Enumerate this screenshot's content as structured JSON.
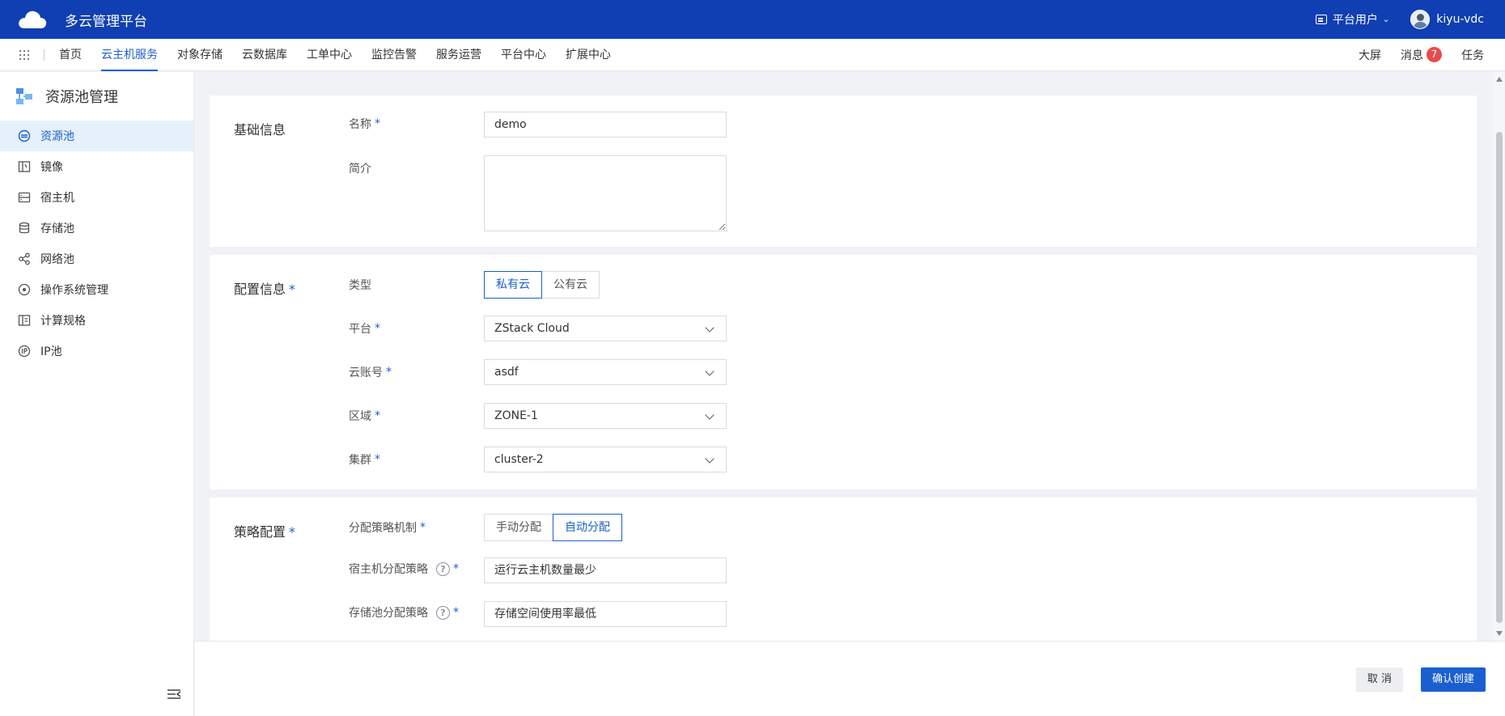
{
  "header": {
    "app_title": "多云管理平台",
    "role_label": "平台用户",
    "username": "kiyu-vdc"
  },
  "nav": {
    "items": [
      "首页",
      "云主机服务",
      "对象存储",
      "云数据库",
      "工单中心",
      "监控告警",
      "服务运营",
      "平台中心",
      "扩展中心"
    ],
    "active_index": 1,
    "right": {
      "screen": "大屏",
      "messages": "消息",
      "message_count": "7",
      "tasks": "任务"
    }
  },
  "sidebar": {
    "title": "资源池管理",
    "items": [
      {
        "label": "资源池",
        "icon": "resource-pool-icon"
      },
      {
        "label": "镜像",
        "icon": "image-icon"
      },
      {
        "label": "宿主机",
        "icon": "host-icon"
      },
      {
        "label": "存储池",
        "icon": "storage-pool-icon"
      },
      {
        "label": "网络池",
        "icon": "network-pool-icon"
      },
      {
        "label": "操作系统管理",
        "icon": "os-icon"
      },
      {
        "label": "计算规格",
        "icon": "compute-spec-icon"
      },
      {
        "label": "IP池",
        "icon": "ip-pool-icon"
      }
    ],
    "active_index": 0
  },
  "form": {
    "basic": {
      "title": "基础信息",
      "name_label": "名称",
      "name_value": "demo",
      "desc_label": "简介",
      "desc_value": ""
    },
    "config": {
      "title": "配置信息",
      "type_label": "类型",
      "type_options": [
        "私有云",
        "公有云"
      ],
      "type_selected": 0,
      "platform_label": "平台",
      "platform_value": "ZStack Cloud",
      "account_label": "云账号",
      "account_value": "asdf",
      "zone_label": "区域",
      "zone_value": "ZONE-1",
      "cluster_label": "集群",
      "cluster_value": "cluster-2"
    },
    "policy": {
      "title": "策略配置",
      "mechanism_label": "分配策略机制",
      "mechanism_options": [
        "手动分配",
        "自动分配"
      ],
      "mechanism_selected": 1,
      "host_policy_label": "宿主机分配策略",
      "host_policy_value": "运行云主机数量最少",
      "storage_policy_label": "存储池分配策略",
      "storage_policy_value": "存储空间使用率最低"
    },
    "required_mark": "*",
    "help_glyph": "?"
  },
  "footer": {
    "cancel": "取 消",
    "confirm": "确认创建"
  },
  "colors": {
    "header_bg": "#0f3fb2",
    "accent": "#1a5fd0",
    "badge": "#e94b4b"
  }
}
